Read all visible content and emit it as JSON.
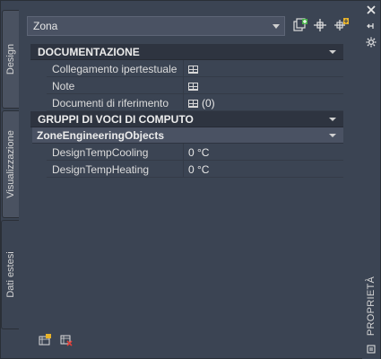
{
  "toolbar": {
    "object_type": "Zona"
  },
  "tabs": [
    {
      "label": "Design"
    },
    {
      "label": "Visualizzazione"
    },
    {
      "label": "Dati estesi"
    }
  ],
  "palette_title": "PROPRIETÀ",
  "sections": {
    "doc": {
      "title": "DOCUMENTAZIONE",
      "rows": [
        {
          "label": "Collegamento ipertestuale",
          "value": ""
        },
        {
          "label": "Note",
          "value": ""
        },
        {
          "label": "Documenti di riferimento",
          "value": "(0)"
        }
      ]
    },
    "groups": {
      "title": "GRUPPI DI VOCI DI COMPUTO"
    },
    "engineering": {
      "title": "ZoneEngineeringObjects",
      "rows": [
        {
          "label": "DesignTempCooling",
          "value": "0 °C"
        },
        {
          "label": "DesignTempHeating",
          "value": "0 °C"
        }
      ]
    }
  },
  "icons": {
    "table": "table-icon",
    "quick_select": "quick-select-icon",
    "select_objects": "select-objects-icon",
    "toggle_pickadd": "pickadd-icon",
    "close": "close-icon",
    "autohide": "autohide-icon",
    "settings": "settings-icon",
    "add_property_set": "add-property-set-icon",
    "remove_property_set": "remove-property-set-icon"
  }
}
